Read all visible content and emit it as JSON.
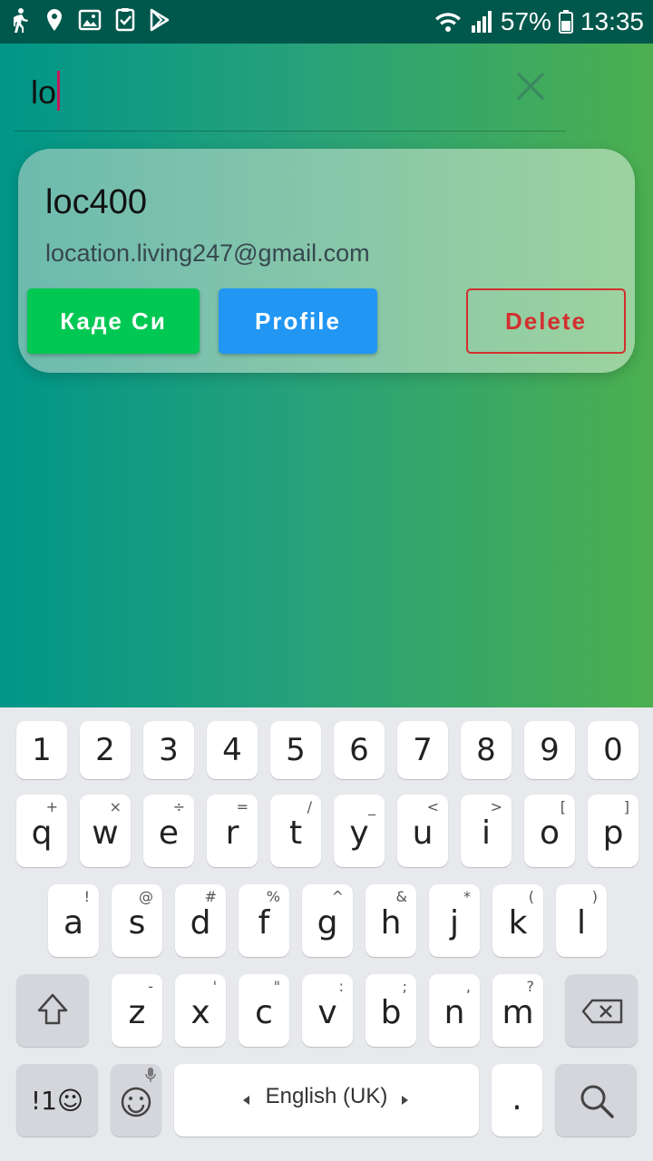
{
  "status_bar": {
    "battery": "57%",
    "time": "13:35"
  },
  "search": {
    "value": "lo"
  },
  "card": {
    "title": "loc400",
    "email": "location.living247@gmail.com",
    "buttons": {
      "kade": "Каде Си",
      "profile": "Profile",
      "delete": "Delete"
    }
  },
  "keyboard": {
    "numbers": [
      "1",
      "2",
      "3",
      "4",
      "5",
      "6",
      "7",
      "8",
      "9",
      "0"
    ],
    "row1": [
      {
        "k": "q",
        "s": "+"
      },
      {
        "k": "w",
        "s": "×"
      },
      {
        "k": "e",
        "s": "÷"
      },
      {
        "k": "r",
        "s": "="
      },
      {
        "k": "t",
        "s": "/"
      },
      {
        "k": "y",
        "s": "_"
      },
      {
        "k": "u",
        "s": "<"
      },
      {
        "k": "i",
        "s": ">"
      },
      {
        "k": "o",
        "s": "["
      },
      {
        "k": "p",
        "s": "]"
      }
    ],
    "row2": [
      {
        "k": "a",
        "s": "!"
      },
      {
        "k": "s",
        "s": "@"
      },
      {
        "k": "d",
        "s": "#"
      },
      {
        "k": "f",
        "s": "%"
      },
      {
        "k": "g",
        "s": "^"
      },
      {
        "k": "h",
        "s": "&"
      },
      {
        "k": "j",
        "s": "*"
      },
      {
        "k": "k",
        "s": "("
      },
      {
        "k": "l",
        "s": ")"
      }
    ],
    "row3": [
      {
        "k": "z",
        "s": "-"
      },
      {
        "k": "x",
        "s": "'"
      },
      {
        "k": "c",
        "s": "\""
      },
      {
        "k": "v",
        "s": ":"
      },
      {
        "k": "b",
        "s": ";"
      },
      {
        "k": "n",
        "s": ","
      },
      {
        "k": "m",
        "s": "?"
      }
    ],
    "symbols_label": "!1☺",
    "space_label": "English (UK)",
    "period": "."
  }
}
